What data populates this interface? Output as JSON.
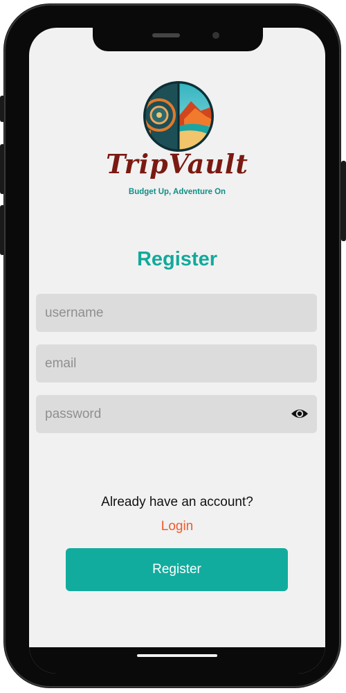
{
  "app": {
    "brand": "TripVault",
    "tagline": "Budget Up, Adventure On"
  },
  "form": {
    "title": "Register",
    "username": {
      "placeholder": "username",
      "value": ""
    },
    "email": {
      "placeholder": "email",
      "value": ""
    },
    "password": {
      "placeholder": "password",
      "value": "",
      "toggle_icon": "eye-icon"
    }
  },
  "footer": {
    "prompt": "Already have an account?",
    "login_label": "Login",
    "register_label": "Register"
  },
  "colors": {
    "accent": "#12ac9e",
    "title": "#12a99c",
    "link": "#f1592a",
    "brand_text": "#7a1a12",
    "field_bg": "#dcdcdc",
    "screen_bg": "#f1f1f1"
  }
}
